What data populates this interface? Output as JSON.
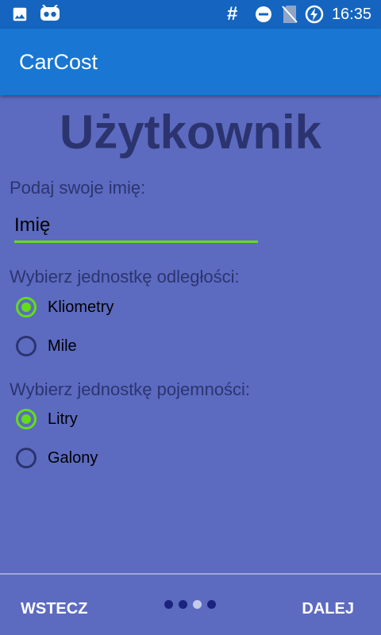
{
  "status_bar": {
    "time": "16:35",
    "icons": [
      "image-icon",
      "android-icon",
      "hash-icon",
      "dnd-icon",
      "no-sim-icon",
      "battery-charging-icon"
    ]
  },
  "app_bar": {
    "title": "CarCost"
  },
  "page": {
    "heading": "Użytkownik",
    "name_label": "Podaj swoje imię:",
    "name_input": {
      "value": "",
      "placeholder": "Imię"
    },
    "distance": {
      "label": "Wybierz jednostkę odległości:",
      "options": [
        {
          "label": "Kliometry",
          "checked": true
        },
        {
          "label": "Mile",
          "checked": false
        }
      ]
    },
    "capacity": {
      "label": "Wybierz jednostkę pojemności:",
      "options": [
        {
          "label": "Litry",
          "checked": true
        },
        {
          "label": "Galony",
          "checked": false
        }
      ]
    }
  },
  "footer": {
    "back_label": "WSTECZ",
    "next_label": "DALEJ",
    "page_count": 4,
    "current_page": 3
  },
  "colors": {
    "status_bar": "#1565c0",
    "app_bar": "#1976d2",
    "background": "#5c6bc0",
    "accent": "#64dd17",
    "text_dark": "#2c3470"
  }
}
